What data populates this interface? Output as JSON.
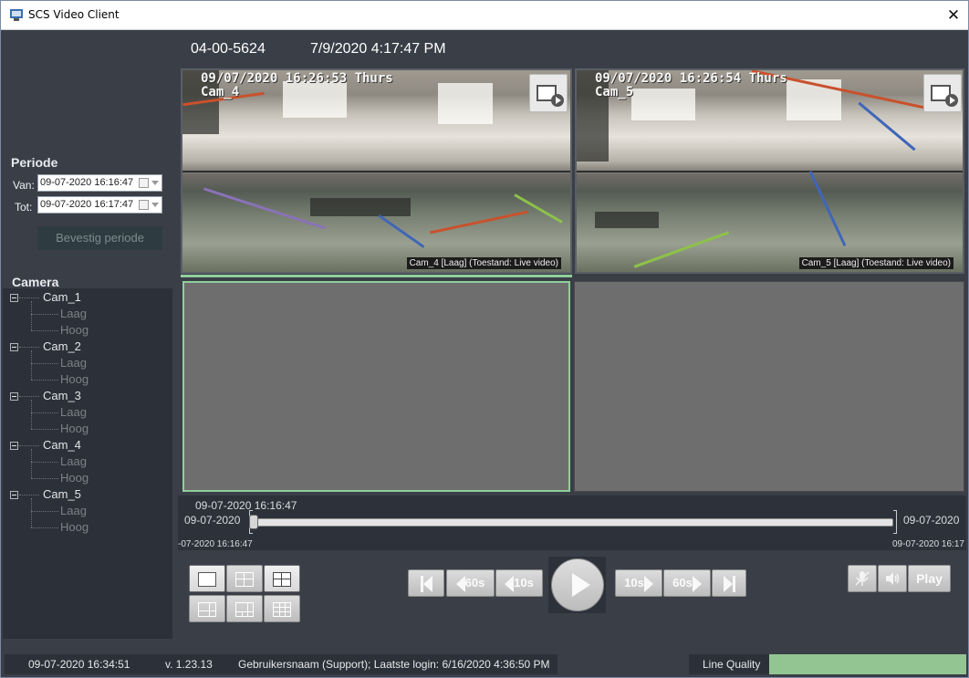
{
  "window": {
    "title": "SCS Video Client",
    "close_glyph": "✕"
  },
  "header": {
    "id": "04-00-5624",
    "datetime": "7/9/2020 4:17:47 PM"
  },
  "periode": {
    "title": "Periode",
    "van_label": "Van:",
    "van_value": "09-07-2020 16:16:47",
    "tot_label": "Tot:",
    "tot_value": "09-07-2020 16:17:47",
    "confirm_label": "Bevestig periode"
  },
  "camera": {
    "title": "Camera",
    "cams": [
      {
        "name": "Cam_1",
        "subs": [
          "Laag",
          "Hoog"
        ]
      },
      {
        "name": "Cam_2",
        "subs": [
          "Laag",
          "Hoog"
        ]
      },
      {
        "name": "Cam_3",
        "subs": [
          "Laag",
          "Hoog"
        ]
      },
      {
        "name": "Cam_4",
        "subs": [
          "Laag",
          "Hoog"
        ]
      },
      {
        "name": "Cam_5",
        "subs": [
          "Laag",
          "Hoog"
        ]
      }
    ]
  },
  "tiles": [
    {
      "osd_line1": "09/07/2020 16:26:53 Thurs",
      "osd_line2": "Cam_4",
      "caption": "Cam_4 [Laag] (Toestand: Live video)"
    },
    {
      "osd_line1": "09/07/2020 16:26:54 Thurs",
      "osd_line2": "Cam_5",
      "caption": "Cam_5 [Laag] (Toestand: Live video)"
    }
  ],
  "timeline": {
    "cursor_time": "09-07-2020 16:16:47",
    "start_date": "09-07-2020",
    "end_date": "09-07-2020",
    "start_time": "-07-2020 16:16:47",
    "end_time": "09-07-2020 16:17",
    "position_fraction": 0.0
  },
  "controls": {
    "back60": "60s",
    "back10": "10s",
    "fwd10": "10s",
    "fwd60": "60s",
    "play_label": "Play",
    "layouts": [
      "1x1",
      "2x2",
      "2x2-selected",
      "1+3",
      "1+5",
      "3x3"
    ]
  },
  "status": {
    "datetime": "09-07-2020 16:34:51",
    "version": "v. 1.23.13",
    "user": "Gebruikersnaam (Support); Laatste login: 6/16/2020 4:36:50 PM",
    "line_quality_label": "Line Quality",
    "line_quality_color": "#93c593"
  },
  "colors": {
    "background": "#3a3e47",
    "panel": "#2c3038",
    "selected_border": "#8fcf9c"
  }
}
